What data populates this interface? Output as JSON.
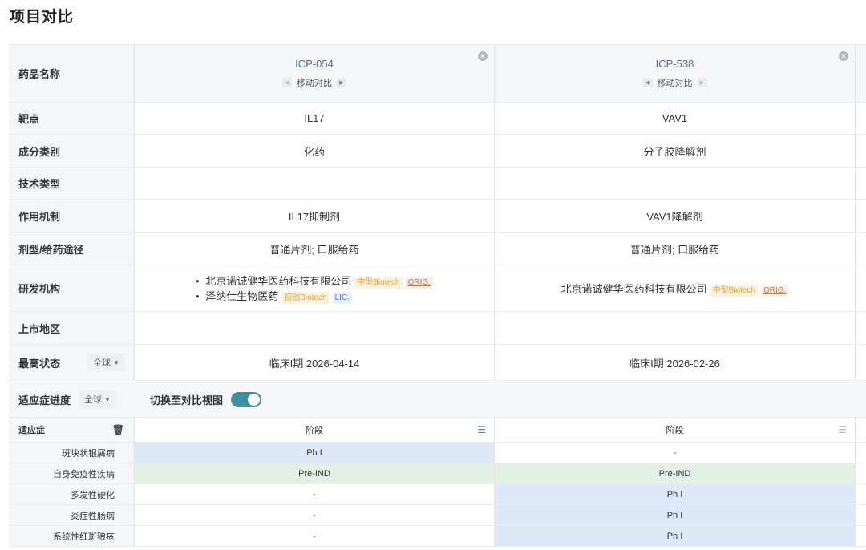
{
  "page": {
    "title": "项目对比"
  },
  "labels": {
    "drug_name": "药品名称",
    "target": "靶点",
    "component": "成分类别",
    "tech_type": "技术类型",
    "mechanism": "作用机制",
    "dosage_route": "剂型/给药途径",
    "developer": "研发机构",
    "market_region": "上市地区",
    "highest_status": "最高状态"
  },
  "status_filter": {
    "value": "全球"
  },
  "drugs": [
    {
      "name": "ICP-054",
      "move_label": "移动对比",
      "target": "IL17",
      "component": "化药",
      "tech_type": "",
      "mechanism": "IL17抑制剂",
      "dosage_route": "普通片剂; 口服给药",
      "developers": [
        {
          "name": "北京诺诚健华医药科技有限公司",
          "tags": [
            "中型Biotech",
            "ORIG."
          ]
        },
        {
          "name": "泽纳仕生物医药",
          "tags": [
            "初创Biotech",
            "LIC."
          ]
        }
      ],
      "market_region": "",
      "highest_status": "临床I期 2026-04-14"
    },
    {
      "name": "ICP-538",
      "move_label": "移动对比",
      "target": "VAV1",
      "component": "分子胶降解剂",
      "tech_type": "",
      "mechanism": "VAV1降解剂",
      "dosage_route": "普通片剂; 口服给药",
      "developers": [
        {
          "name": "北京诺诚健华医药科技有限公司",
          "tags": [
            "中型Biotech",
            "ORIG."
          ]
        }
      ],
      "market_region": "",
      "highest_status": "临床I期 2026-02-26"
    }
  ],
  "indication_bar": {
    "label": "适应症进度",
    "filter": "全球",
    "switch_label": "切换至对比视图",
    "switch_on": true
  },
  "indications": {
    "header_label": "适应症",
    "stage_header": "阶段",
    "rows": [
      {
        "name": "斑块状银屑病",
        "values": [
          "Ph I",
          "-"
        ]
      },
      {
        "name": "自身免疫性疾病",
        "values": [
          "Pre-IND",
          "Pre-IND"
        ]
      },
      {
        "name": "多发性硬化",
        "values": [
          "-",
          "Ph I"
        ]
      },
      {
        "name": "炎症性肠病",
        "values": [
          "-",
          "Ph I"
        ]
      },
      {
        "name": "系统性红斑狼疮",
        "values": [
          "-",
          "Ph I"
        ]
      }
    ]
  },
  "colors": {
    "accent": "#3f8fa0",
    "link": "#4a6fa5",
    "ph1_bg": "#dde9f8",
    "preind_bg": "#e4f0e6"
  }
}
